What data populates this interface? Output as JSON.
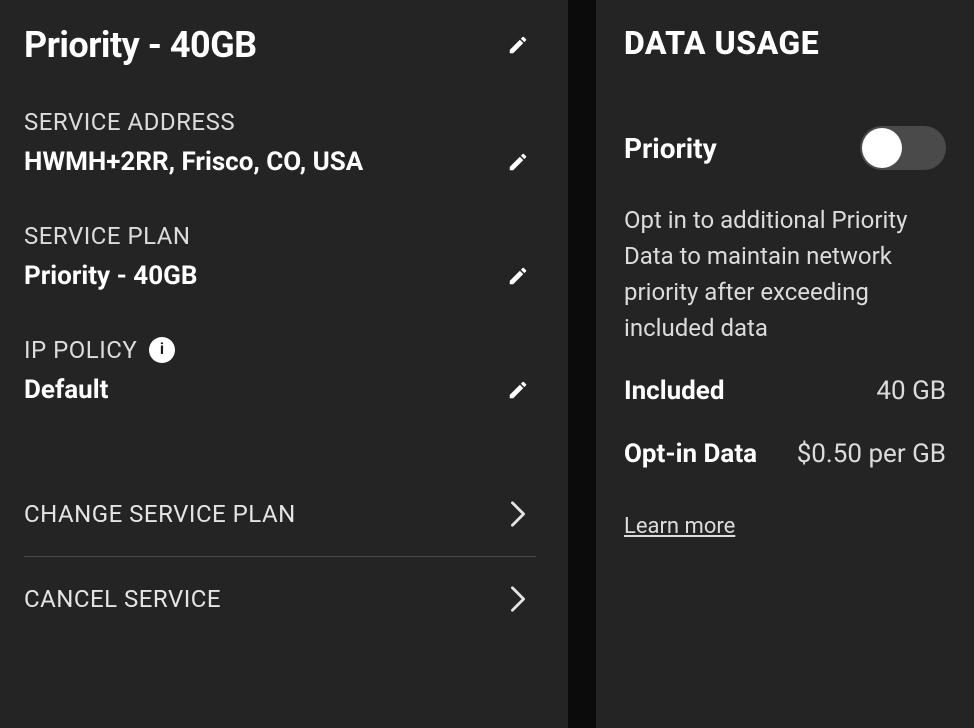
{
  "left": {
    "plan_title": "Priority - 40GB",
    "sections": {
      "address": {
        "label": "SERVICE ADDRESS",
        "value": "HWMH+2RR, Frisco, CO, USA"
      },
      "plan": {
        "label": "SERVICE PLAN",
        "value": "Priority - 40GB"
      },
      "ip": {
        "label": "IP POLICY",
        "value": "Default"
      }
    },
    "actions": {
      "change": "CHANGE SERVICE PLAN",
      "cancel": "CANCEL SERVICE"
    }
  },
  "right": {
    "title": "DATA USAGE",
    "toggle_label": "Priority",
    "toggle_on": false,
    "hint": "Opt in to additional Priority Data to maintain network priority after exceeding included data",
    "included": {
      "label": "Included",
      "value": "40 GB"
    },
    "optin": {
      "label": "Opt-in Data",
      "value": "$0.50 per GB"
    },
    "learn_more": "Learn more"
  },
  "icons": {
    "info_char": "i"
  }
}
